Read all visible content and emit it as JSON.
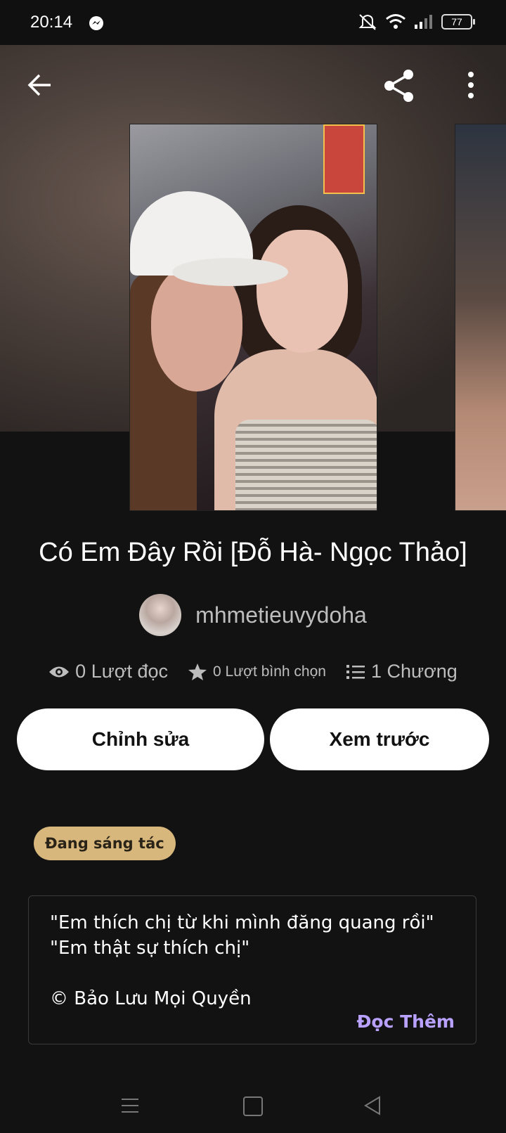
{
  "status_bar": {
    "time": "20:14",
    "battery": "77",
    "icons": [
      "messenger-icon",
      "mute-icon",
      "wifi-icon",
      "signal-icon",
      "battery-icon"
    ]
  },
  "toolbar": {
    "icons": [
      "back-arrow-icon",
      "share-icon",
      "more-vertical-icon"
    ]
  },
  "story": {
    "title": "Có Em Đây Rồi   [Đỗ Hà- Ngọc Thảo]",
    "author": "mhmetieuvydoha",
    "stats": {
      "reads": "0 Lượt đọc",
      "votes": "0 Lượt bình chọn",
      "chapters": "1 Chương"
    },
    "status_badge": "Đang sáng tác",
    "description": [
      "\"Em thích chị từ khi mình đăng quang rồi\"",
      "\"Em thật sự thích chị\"",
      "",
      "© Bảo Lưu Mọi Quyền"
    ],
    "read_more": "Đọc Thêm"
  },
  "actions": {
    "edit_label": "Chỉnh sửa",
    "preview_label": "Xem trước"
  },
  "colors": {
    "background": "#121212",
    "badge": "#d8b77c",
    "accent_link": "#b9a2ff",
    "button_bg": "#ffffff"
  }
}
